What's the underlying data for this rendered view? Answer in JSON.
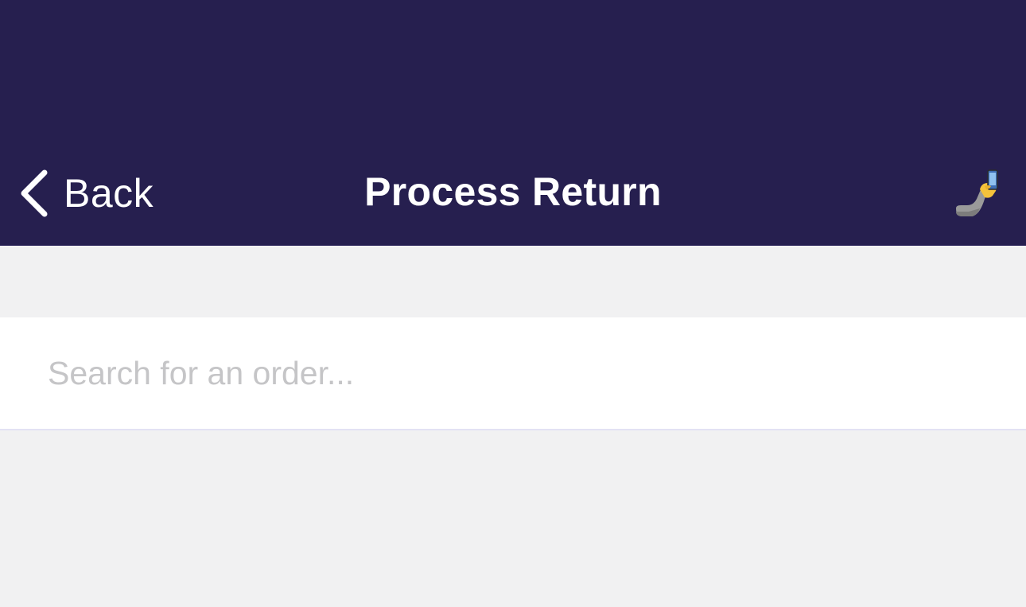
{
  "navbar": {
    "back_label": "Back",
    "title": "Process Return",
    "background_color": "#261f4f",
    "scan_icon": "hand-holding-phone-icon"
  },
  "search": {
    "value": "",
    "placeholder": "Search for an order..."
  },
  "colors": {
    "page_background": "#f1f1f2",
    "placeholder": "#c5c5c7"
  }
}
